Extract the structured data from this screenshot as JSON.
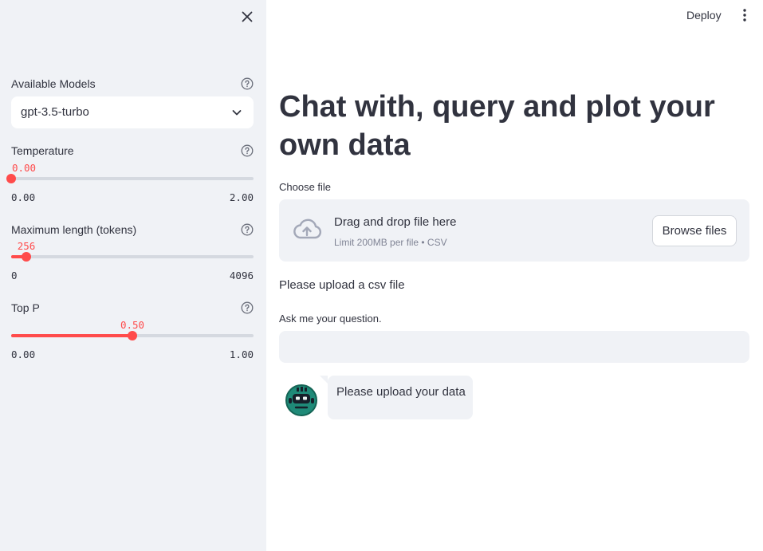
{
  "sidebar": {
    "close_icon": "close-icon",
    "model_select": {
      "label": "Available Models",
      "value": "gpt-3.5-turbo"
    },
    "temperature": {
      "label": "Temperature",
      "value": "0.00",
      "min": "0.00",
      "max": "2.00",
      "fraction": 0.0
    },
    "max_length": {
      "label": "Maximum length (tokens)",
      "value": "256",
      "min": "0",
      "max": "4096",
      "fraction": 0.0625
    },
    "top_p": {
      "label": "Top P",
      "value": "0.50",
      "min": "0.00",
      "max": "1.00",
      "fraction": 0.5
    }
  },
  "header": {
    "deploy_label": "Deploy",
    "menu_icon": "more-vertical-icon"
  },
  "main": {
    "title": "Chat with, query and plot your own data",
    "file_upload": {
      "label": "Choose file",
      "dropzone_title": "Drag and drop file here",
      "dropzone_subtitle": "Limit 200MB per file • CSV",
      "browse_label": "Browse files"
    },
    "upload_message": "Please upload a csv file",
    "question": {
      "label": "Ask me your question.",
      "value": ""
    },
    "chat": [
      {
        "role": "assistant",
        "avatar": "robot-avatar",
        "text": "Please upload your data"
      }
    ]
  },
  "colors": {
    "accent": "#ff4b4b",
    "sidebar_bg": "#f0f2f6",
    "text": "#31333f"
  }
}
